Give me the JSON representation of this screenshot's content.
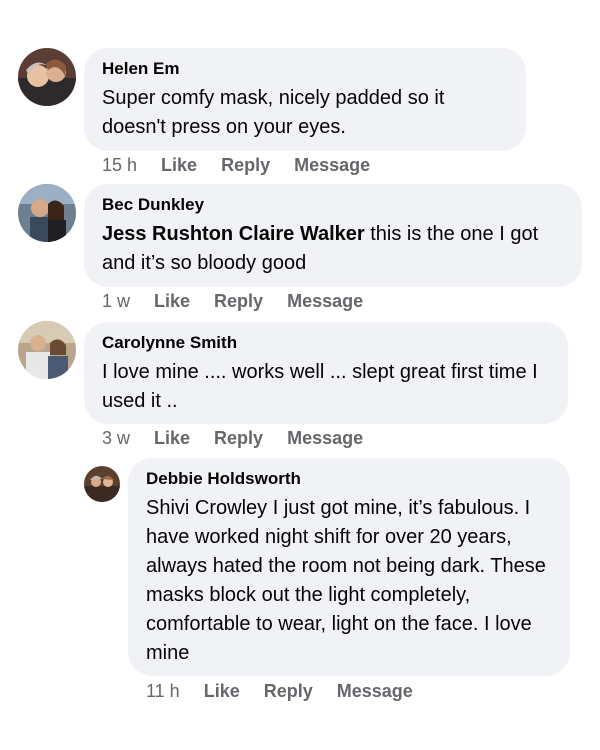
{
  "comments": [
    {
      "author": "Helen Em",
      "mention": "",
      "text": "Super comfy mask, nicely padded so it doesn't press on your eyes.",
      "time": "15 h",
      "like": "Like",
      "reply": "Reply",
      "message": "Message"
    },
    {
      "author": "Bec Dunkley",
      "mention": "Jess Rushton Claire Walker",
      "text": " this is the one I got and it’s so bloody good",
      "time": "1 w",
      "like": "Like",
      "reply": "Reply",
      "message": "Message"
    },
    {
      "author": "Carolynne Smith",
      "mention": "",
      "text": "I love mine .... works well ... slept great first time I used it ..",
      "time": "3 w",
      "like": "Like",
      "reply": "Reply",
      "message": "Message"
    },
    {
      "author": "Debbie Holdsworth",
      "mention": "",
      "text": "Shivi Crowley I just got mine, it’s fabulous. I have worked night shift for over 20 years, always hated the room not being dark. These masks block out the light completely, comfortable to wear, light on the face. I love mine",
      "time": "11 h",
      "like": "Like",
      "reply": "Reply",
      "message": "Message"
    }
  ],
  "colors": {
    "bubble": "#f0f2f5",
    "meta_text": "#65676b",
    "text": "#050505"
  }
}
